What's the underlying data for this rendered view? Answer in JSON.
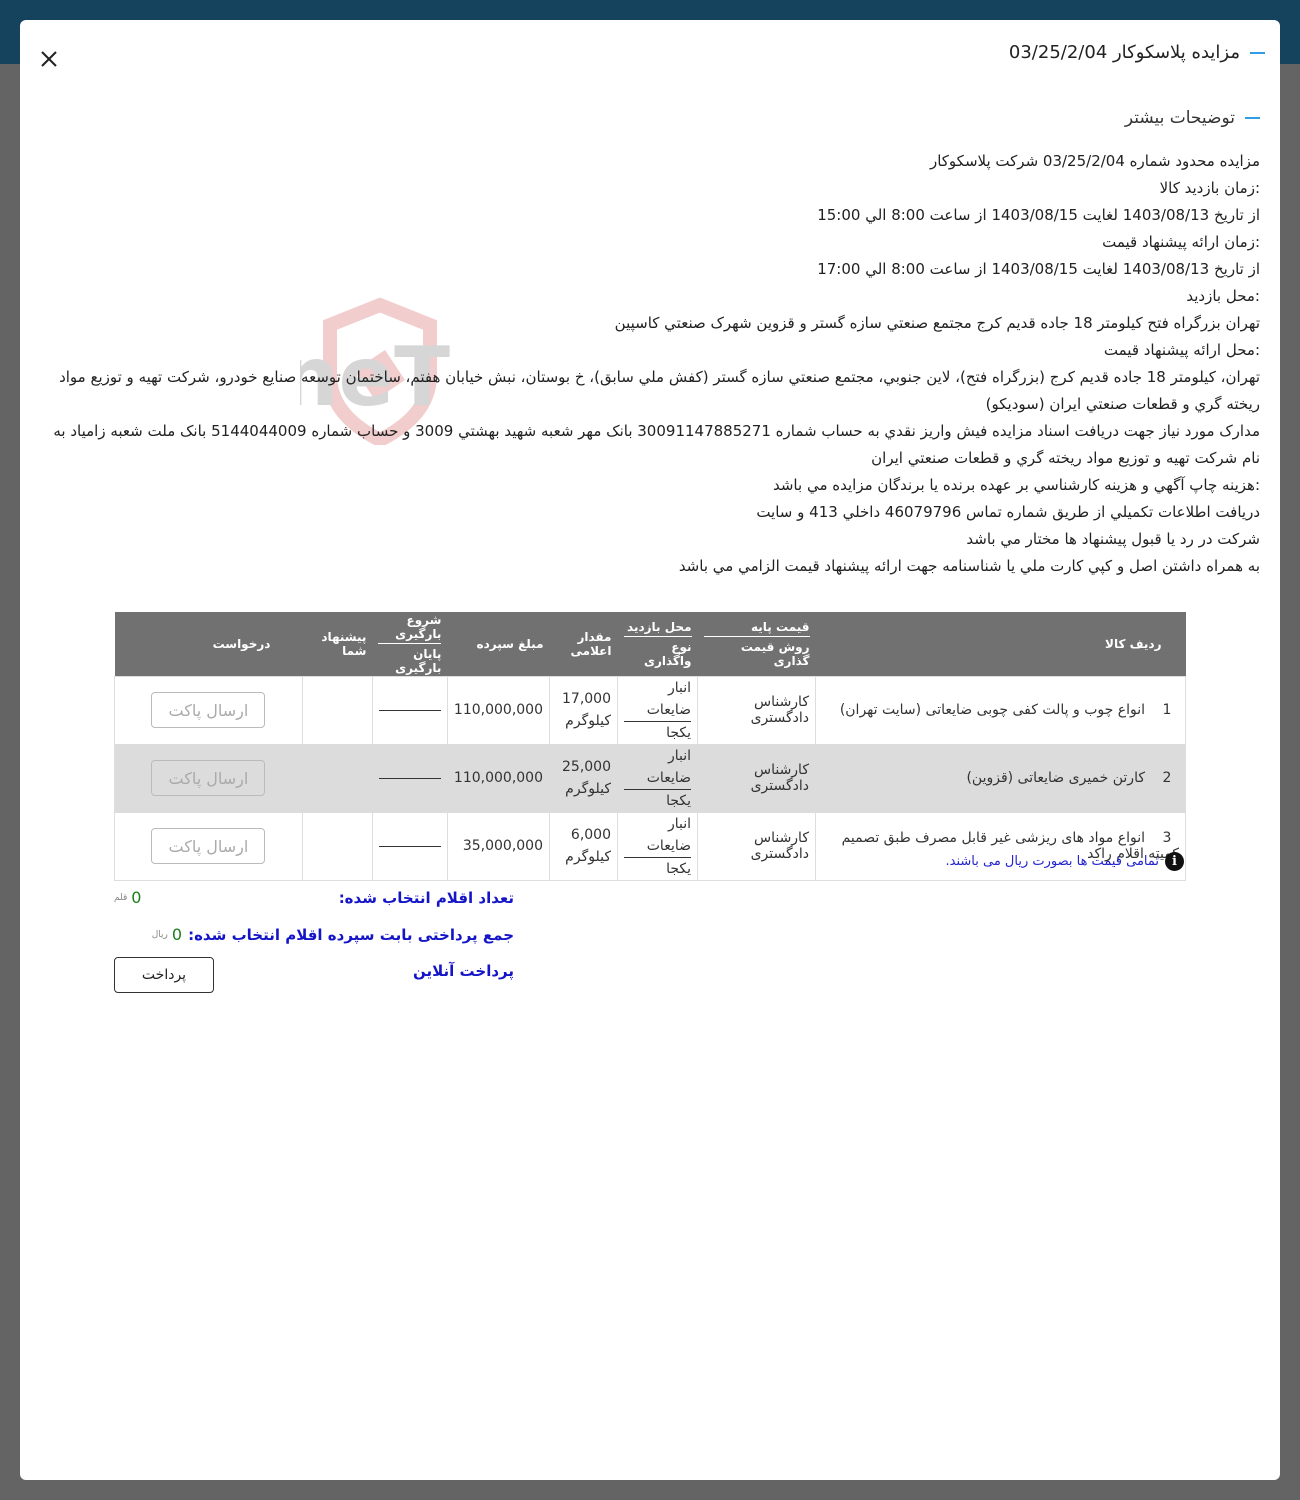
{
  "modal": {
    "title": "مزایده پلاسکوکار 03/25/2/04",
    "close_icon": "close-icon"
  },
  "section": {
    "title": "توضیحات بیشتر"
  },
  "description": [
    "مزايده محدود شماره 03/25/2/04 شركت پلاسكوكار",
    ":زمان بازديد كالا",
    "از تاريخ 1403/08/13 لغايت 1403/08/15 از ساعت 8:00 الي 15:00",
    ":زمان ارائه پيشنهاد قيمت",
    "از تاريخ 1403/08/13 لغايت 1403/08/15 از ساعت 8:00 الي 17:00",
    ":محل بازديد",
    "تهران بزرگراه فتح كيلومتر 18 جاده قديم كرج مجتمع صنعتي سازه گستر و قزوين شهرک صنعتي كاسپين",
    ":محل ارائه پيشنهاد قيمت",
    "تهران، كيلومتر 18 جاده قديم كرج (بزرگراه فتح)، لاين جنوبي، مجتمع صنعتي سازه گستر (كفش ملي سابق)، خ بوستان، نبش خيابان هفتم، ساختمان توسعه صنايع خودرو، شركت تهيه و توزيع مواد ريخته گري و قطعات صنعتي ايران (سوديكو)",
    "مدارک مورد نياز جهت دريافت اسناد مزايده فيش واريز نقدي به حساب شماره 30091147885271 بانک مهر شعبه شهيد بهشتي 3009 و حساب شماره 5144044009 بانک ملت شعبه زامياد به نام شركت تهيه و توزيع مواد ريخته گري و قطعات صنعتي ايران",
    ":هزينه چاپ آگهي و هزينه كارشناسي بر عهده برنده يا برندگان مزايده مي باشد",
    "دريافت اطلاعات تكميلي از طريق شماره تماس 46079796 داخلي 413 و سايت",
    "شركت در رد يا قبول پيشنهاد ها مختار مي باشد",
    "به همراه داشتن اصل و كپي كارت ملي يا شناسنامه جهت ارائه پيشنهاد قيمت الزامي مي باشد"
  ],
  "watermark": "AriaTender.neT",
  "table": {
    "headers": {
      "row_item": "ردیف کالا",
      "base_price": "قیمت پایه",
      "pricing_method": "روش قیمت گذاری",
      "visit_place": "محل بازدید",
      "transfer_type": "نوع واگذاری",
      "declared_qty": "مقدار اعلامی",
      "deposit": "مبلغ سپرده",
      "load_start": "شروع بارگیری",
      "load_end": "پایان بارگیری",
      "your_offer": "پیشنهاد شما",
      "request": "درخواست"
    },
    "rows": [
      {
        "num": "1",
        "item": "انواع چوب و پالت کفی چوبی ضایعاتی (سایت تهران)",
        "pricing": "کارشناس دادگستری",
        "visit_place": "انبار ضایعات",
        "transfer_type": "یکجا",
        "qty": "17,000",
        "unit": "کیلوگرم",
        "deposit": "110,000,000",
        "loading": "———",
        "offer": "",
        "button": "ارسال پاکت"
      },
      {
        "num": "2",
        "item": "کارتن خمیری ضایعاتی (قزوین)",
        "pricing": "کارشناس دادگستری",
        "visit_place": "انبار ضایعات",
        "transfer_type": "یکجا",
        "qty": "25,000",
        "unit": "کیلوگرم",
        "deposit": "110,000,000",
        "loading": "———",
        "offer": "",
        "button": "ارسال پاکت"
      },
      {
        "num": "3",
        "item": "انواع مواد های ریزشی غیر قابل مصرف طبق تصمیم کمیته اقلام راکد",
        "pricing": "کارشناس دادگستری",
        "visit_place": "انبار ضایعات",
        "transfer_type": "یکجا",
        "qty": "6,000",
        "unit": "کیلوگرم",
        "deposit": "35,000,000",
        "loading": "———",
        "offer": "",
        "button": "ارسال پاکت"
      }
    ]
  },
  "note": {
    "icon": "info-icon",
    "text": "تمامی قیمت ها بصورت ریال می باشند."
  },
  "summary": {
    "selected_count_label": "تعداد اقلام انتخاب شده:",
    "selected_count_value": "0",
    "selected_count_unit": "قلم",
    "total_label": "جمع پرداختی بابت سپرده اقلام انتخاب شده:",
    "total_value": "0",
    "total_unit": "ریال",
    "online_pay_label": "پرداخت آنلاین",
    "pay_button": "پرداخت"
  },
  "colors": {
    "topbar": "#15435e",
    "accent_dash": "#2f9ee4",
    "table_header": "#707170",
    "link_blue": "#1515c8",
    "value_green": "#1a7f1a"
  }
}
